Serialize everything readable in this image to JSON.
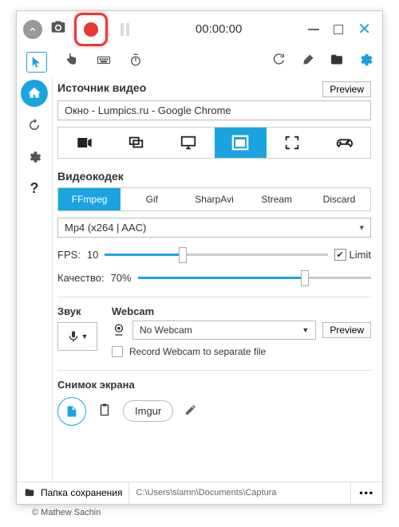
{
  "titlebar": {
    "timer": "00:00:00"
  },
  "sections": {
    "videoSource": {
      "title": "Источник видео",
      "previewLabel": "Preview",
      "selectedWindow": "Окно  -  Lumpics.ru - Google Chrome"
    },
    "videoCodec": {
      "title": "Видеокодек",
      "tabs": {
        "ffmpeg": "FFmpeg",
        "gif": "Gif",
        "sharpavi": "SharpAvi",
        "stream": "Stream",
        "discard": "Discard"
      },
      "formatDropdown": "Mp4 (x264 | AAC)",
      "fpsLabel": "FPS:",
      "fpsValue": "10",
      "limitLabel": "Limit",
      "qualityLabel": "Качество:",
      "qualityValue": "70%"
    },
    "sound": {
      "title": "Звук"
    },
    "webcam": {
      "title": "Webcam",
      "dropdown": "No Webcam",
      "previewLabel": "Preview",
      "recordSeparate": "Record Webcam to separate file"
    },
    "screenshot": {
      "title": "Снимок экрана",
      "imgur": "Imgur"
    }
  },
  "footer": {
    "folderLabel": "Папка сохранения",
    "path": "C:\\Users\\slamn\\Documents\\Captura"
  },
  "credit": "© Mathew Sachin"
}
